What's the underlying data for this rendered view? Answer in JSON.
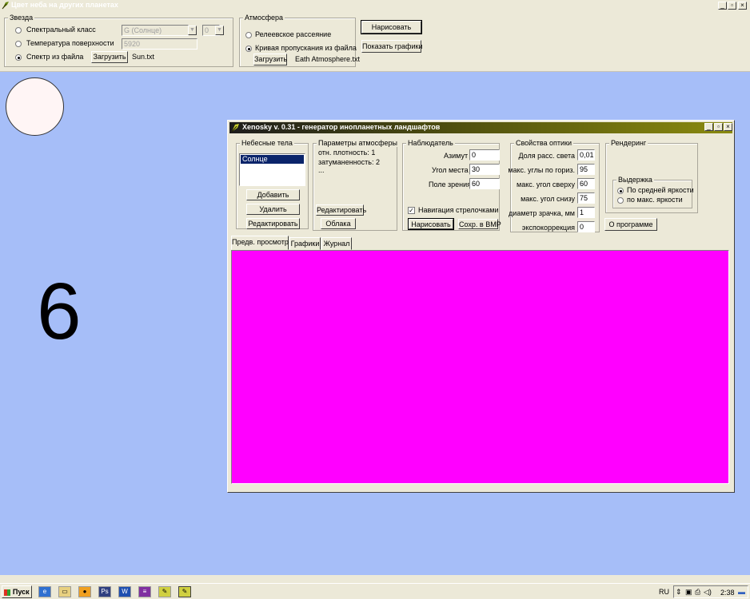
{
  "window": {
    "title": "Цвет неба на других планетах",
    "controls": {
      "minimize": "_",
      "maximize": "▫",
      "close": "×"
    }
  },
  "star_group": {
    "title": "Звезда",
    "options": [
      {
        "label": "Спектральный класс",
        "checked": false
      },
      {
        "label": "Температура поверхности",
        "checked": false
      },
      {
        "label": "Спектр из файла",
        "checked": true
      }
    ],
    "spectral_class_value": "G (Солнце)",
    "spectral_subclass_value": "0",
    "temperature_value": "5920",
    "load_button": "Загрузить",
    "file_name": "Sun.txt"
  },
  "atmosphere_group": {
    "title": "Атмосфера",
    "options": [
      {
        "label": "Релеевское рассеяние",
        "checked": false
      },
      {
        "label": "Кривая пропускания из файла",
        "checked": true
      }
    ],
    "load_button": "Загрузить",
    "file_name": "Eath Atmosphere.txt"
  },
  "toolbar": {
    "draw_button": "Нарисовать",
    "show_graphs_button": "Показать графики"
  },
  "canvas": {
    "big_number": "6",
    "sun_color": "#fff5f5",
    "background_color": "#a6bef8"
  },
  "xenosky": {
    "title": "Xenosky v. 0.31 - генератор инопланетных ландшафтов",
    "controls": {
      "minimize": "_",
      "maximize": "▫",
      "close": "×"
    },
    "bodies_group": {
      "title": "Небесные тела",
      "items": [
        "Солнце"
      ],
      "add_button": "Добавить",
      "delete_button": "Удалить",
      "edit_button": "Редактировать"
    },
    "atm_params_group": {
      "title": "Параметры атмосферы",
      "lines": [
        "отн. плотность: 1",
        "затуманенность: 2",
        "..."
      ],
      "edit_button": "Редактировать",
      "clouds_button": "Облака"
    },
    "observer_group": {
      "title": "Наблюдатель",
      "fields": [
        {
          "label": "Азимут",
          "value": "0"
        },
        {
          "label": "Угол места",
          "value": "30"
        },
        {
          "label": "Поле зрения",
          "value": "60"
        }
      ],
      "arrow_nav_label": "Навигация стрелочками",
      "arrow_nav_checked": true,
      "arrow_nav_mark": "✓",
      "draw_button": "Нарисовать",
      "save_bmp_button": "Сохр. в BMP"
    },
    "optics_group": {
      "title": "Свойства оптики",
      "fields": [
        {
          "label": "Доля расс. света",
          "value": "0,01"
        },
        {
          "label": "макс. углы по гориз.",
          "value": "95"
        },
        {
          "label": "макс. угол сверху",
          "value": "60"
        },
        {
          "label": "макс. угол снизу",
          "value": "75"
        },
        {
          "label": "диаметр зрачка, мм",
          "value": "1"
        },
        {
          "label": "экспокоррекция",
          "value": "0"
        }
      ]
    },
    "rendering_group": {
      "title": "Рендеринг",
      "exposure_group": {
        "title": "Выдержка",
        "options": [
          {
            "label": "По средней яркости",
            "checked": true
          },
          {
            "label": "по макс. яркости",
            "checked": false
          }
        ]
      }
    },
    "about_button": "О программе",
    "tabs": [
      {
        "label": "Предв. просмотр",
        "active": true
      },
      {
        "label": "Графики",
        "active": false
      },
      {
        "label": "Журнал",
        "active": false
      }
    ],
    "preview_color": "#ff00ff"
  },
  "taskbar": {
    "start_label": "Пуск",
    "language": "RU",
    "clock": "2:38",
    "icons": [
      "ie-icon",
      "explorer-icon",
      "media-icon",
      "photoshop-icon",
      "word-icon",
      "winrar-icon",
      "xenosky-icon",
      "sky-app-icon"
    ]
  }
}
